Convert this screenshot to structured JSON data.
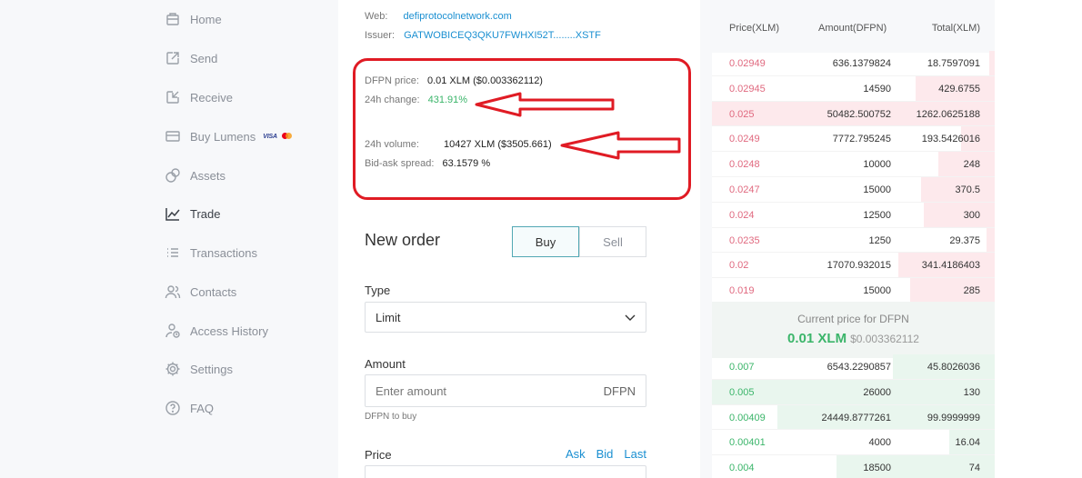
{
  "sidebar": {
    "items": [
      {
        "label": "Home",
        "icon": "home-icon"
      },
      {
        "label": "Send",
        "icon": "send-icon"
      },
      {
        "label": "Receive",
        "icon": "receive-icon"
      },
      {
        "label": "Buy Lumens",
        "icon": "card-icon",
        "badge": "VISA"
      },
      {
        "label": "Assets",
        "icon": "assets-icon"
      },
      {
        "label": "Trade",
        "icon": "chart-icon",
        "active": true
      },
      {
        "label": "Transactions",
        "icon": "list-icon"
      },
      {
        "label": "Contacts",
        "icon": "contacts-icon"
      },
      {
        "label": "Access History",
        "icon": "user-history-icon"
      },
      {
        "label": "Settings",
        "icon": "gear-icon"
      },
      {
        "label": "FAQ",
        "icon": "help-icon"
      }
    ]
  },
  "asset_info": {
    "web_label": "Web:",
    "web_value": "defiprotocolnetwork.com",
    "issuer_label": "Issuer:",
    "issuer_value": "GATWOBICEQ3QKU7FWHXI52T........XSTF",
    "price_label": "DFPN price:",
    "price_value": "0.01 XLM ($0.003362112)",
    "change_label": "24h change:",
    "change_value": "431.91%",
    "volume_label": "24h volume:",
    "volume_value": "10427 XLM ($3505.661)",
    "spread_label": "Bid-ask spread:",
    "spread_value": "63.1579 %"
  },
  "order": {
    "title": "New order",
    "buy_label": "Buy",
    "sell_label": "Sell",
    "type_label": "Type",
    "type_value": "Limit",
    "amount_label": "Amount",
    "amount_placeholder": "Enter amount",
    "amount_unit": "DFPN",
    "amount_hint": "DFPN to buy",
    "price_label": "Price",
    "price_ask": "Ask",
    "price_bid": "Bid",
    "price_last": "Last"
  },
  "orderbook": {
    "headers": {
      "price": "Price(XLM)",
      "amount": "Amount(DFPN)",
      "total": "Total(XLM)"
    },
    "asks": [
      {
        "price": "0.02949",
        "amount": "636.1379824",
        "total": "18.7597091",
        "depth": 0.02
      },
      {
        "price": "0.02945",
        "amount": "14590",
        "total": "429.6755",
        "depth": 0.28
      },
      {
        "price": "0.025",
        "amount": "50482.500752",
        "total": "1262.0625188",
        "depth": 1.0
      },
      {
        "price": "0.0249",
        "amount": "7772.795245",
        "total": "193.5426016",
        "depth": 0.12
      },
      {
        "price": "0.0248",
        "amount": "10000",
        "total": "248",
        "depth": 0.2
      },
      {
        "price": "0.0247",
        "amount": "15000",
        "total": "370.5",
        "depth": 0.26
      },
      {
        "price": "0.024",
        "amount": "12500",
        "total": "300",
        "depth": 0.25
      },
      {
        "price": "0.0235",
        "amount": "1250",
        "total": "29.375",
        "depth": 0.03
      },
      {
        "price": "0.02",
        "amount": "17070.932015",
        "total": "341.4186403",
        "depth": 0.34
      },
      {
        "price": "0.019",
        "amount": "15000",
        "total": "285",
        "depth": 0.3
      }
    ],
    "current_label": "Current price for DFPN",
    "current_xlm": "0.01 XLM",
    "current_usd": "$0.003362112",
    "bids": [
      {
        "price": "0.007",
        "amount": "6543.2290857",
        "total": "45.8026036",
        "depth": 0.36
      },
      {
        "price": "0.005",
        "amount": "26000",
        "total": "130",
        "depth": 1.0
      },
      {
        "price": "0.00409",
        "amount": "24449.8777261",
        "total": "99.9999999",
        "depth": 0.77
      },
      {
        "price": "0.00401",
        "amount": "4000",
        "total": "16.04",
        "depth": 0.16
      },
      {
        "price": "0.004",
        "amount": "18500",
        "total": "74",
        "depth": 0.56
      }
    ]
  },
  "colors": {
    "accent": "#1a8fd1",
    "positive": "#3bb56a",
    "negative": "#e0697f",
    "annotation": "#e01b24"
  }
}
